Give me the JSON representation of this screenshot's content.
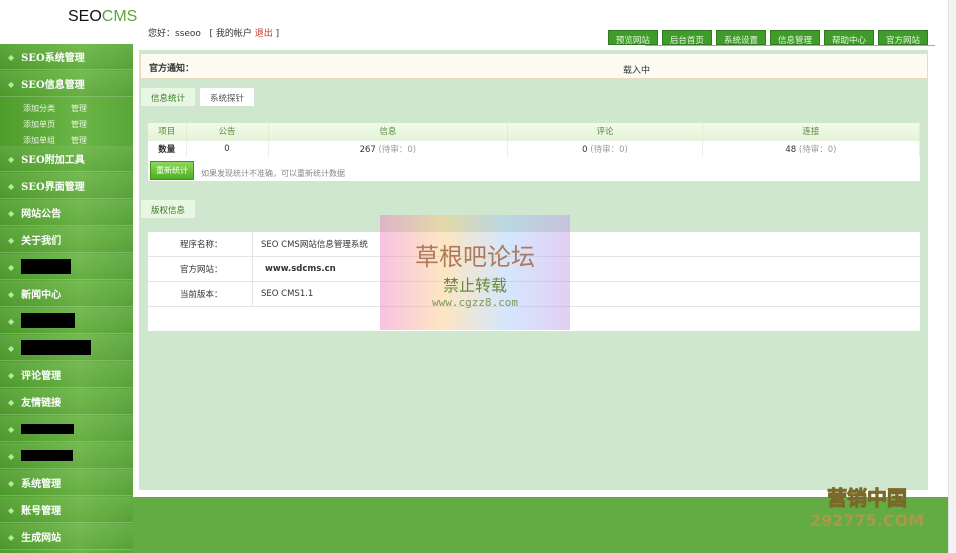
{
  "header": {
    "logo_seo": "SEO",
    "logo_cms": "CMS",
    "greeting": "您好：sseoo",
    "account_open": "[ 我的帐户",
    "logout": "退出",
    "account_close": "]",
    "nav": [
      "预览网站",
      "后台首页",
      "系统设置",
      "信息管理",
      "帮助中心",
      "官方网站"
    ]
  },
  "sidebar": {
    "items": [
      {
        "label": "SEO系统管理"
      },
      {
        "label": "SEO信息管理"
      },
      {
        "label": "SEO附加工具"
      },
      {
        "label": "SEO界面管理"
      },
      {
        "label": "网站公告"
      },
      {
        "label": "关于我们"
      },
      {
        "label": null,
        "redacted": true
      },
      {
        "label": "新闻中心"
      },
      {
        "label": null,
        "redacted": true
      },
      {
        "label": null,
        "redacted": true
      },
      {
        "label": "评论管理"
      },
      {
        "label": "友情链接"
      },
      {
        "label": null,
        "redacted": true
      },
      {
        "label": null,
        "redacted": true
      },
      {
        "label": "系统管理"
      },
      {
        "label": "账号管理"
      },
      {
        "label": "生成网站"
      }
    ],
    "subitems": [
      {
        "add": "添加分类",
        "manage": "管理"
      },
      {
        "add": "添加单页",
        "manage": "管理"
      },
      {
        "add": "添加单组",
        "manage": "管理"
      }
    ]
  },
  "notice": {
    "label": "官方通知：",
    "value": "载入中"
  },
  "tabs": [
    "信息统计",
    "系统探针"
  ],
  "stats": {
    "headers": [
      "项目",
      "公告",
      "信息",
      "评论",
      "连接"
    ],
    "row": {
      "label": "数量",
      "notice": "0",
      "info": "267",
      "info_pending": "(待审：0)",
      "comment": "0",
      "comment_pending": "(待审：0)",
      "link": "48",
      "link_pending": "(待审：0)"
    },
    "recount": "重新统计",
    "hint": "如果发现统计不准确，可以重新统计数据"
  },
  "copyright": {
    "tab": "版权信息",
    "rows": [
      {
        "k": "程序名称：",
        "v": "SEO CMS网站信息管理系统"
      },
      {
        "k": "官方网站：",
        "v": "www.sdcms.cn"
      },
      {
        "k": "当前版本：",
        "v": "SEO CMS1.1"
      }
    ]
  },
  "watermarks": {
    "w1_title": "草根吧论坛",
    "w1_sub": "禁止转载",
    "w1_url": "www.cgzz8.com",
    "w2_title": "营销中国",
    "w2_url": "292775.COM"
  }
}
